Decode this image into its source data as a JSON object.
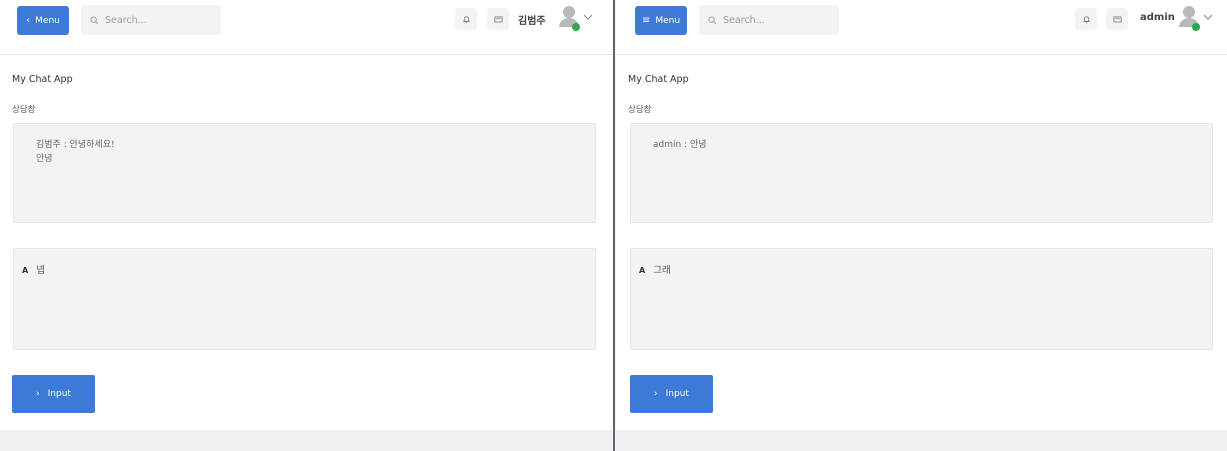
{
  "colors": {
    "accent": "#3c7ad7",
    "panel_bg": "#f3f3f3",
    "footer_bg": "#eef0f3"
  },
  "left": {
    "menu": {
      "icon": "chevron-left-icon",
      "glyph": "‹",
      "label": "Menu"
    },
    "search": {
      "placeholder": "Search..."
    },
    "username": "김범주",
    "app_title": "My Chat App",
    "room_label": "상담창",
    "messages": [
      "김범주 : 안녕하세요!",
      "안녕"
    ],
    "input": {
      "icon_label": "A",
      "value": "넵"
    },
    "submit": {
      "glyph": "›",
      "label": "Input"
    }
  },
  "right": {
    "menu": {
      "icon": "hamburger-icon",
      "glyph": "≡",
      "label": "Menu"
    },
    "search": {
      "placeholder": "Search..."
    },
    "username": "admin",
    "app_title": "My Chat App",
    "room_label": "상담창",
    "messages": [
      "admin : 안녕"
    ],
    "input": {
      "icon_label": "A",
      "value": "그래"
    },
    "submit": {
      "glyph": "›",
      "label": "Input"
    }
  }
}
